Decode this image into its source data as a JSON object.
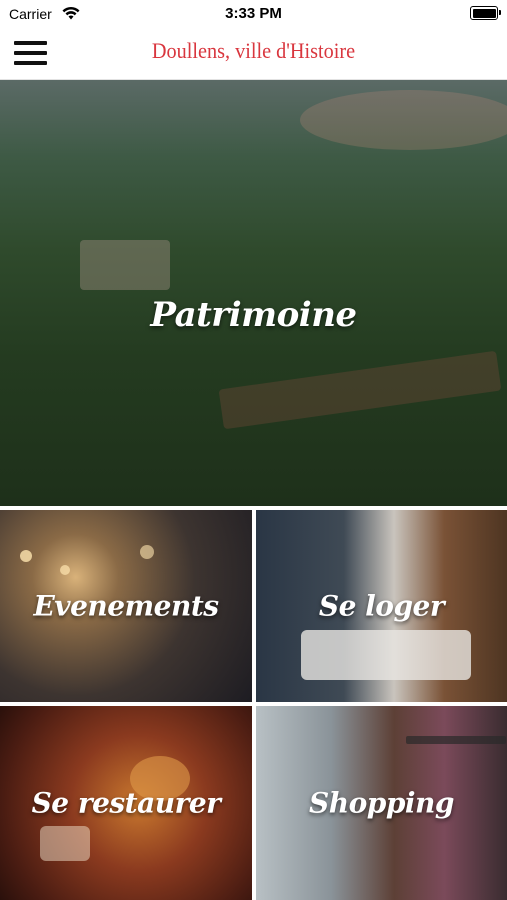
{
  "status_bar": {
    "carrier": "Carrier",
    "time": "3:33 PM",
    "wifi_icon": "wifi-icon",
    "battery_icon": "battery-icon"
  },
  "nav": {
    "menu_icon": "hamburger-menu-icon",
    "title": "Doullens, ville d'Histoire",
    "title_color": "#d9363e"
  },
  "tiles": {
    "hero": {
      "label": "Patrimoine"
    },
    "events": {
      "label": "Evenements"
    },
    "lodging": {
      "label": "Se loger"
    },
    "dining": {
      "label": "Se restaurer"
    },
    "shopping": {
      "label": "Shopping"
    }
  }
}
